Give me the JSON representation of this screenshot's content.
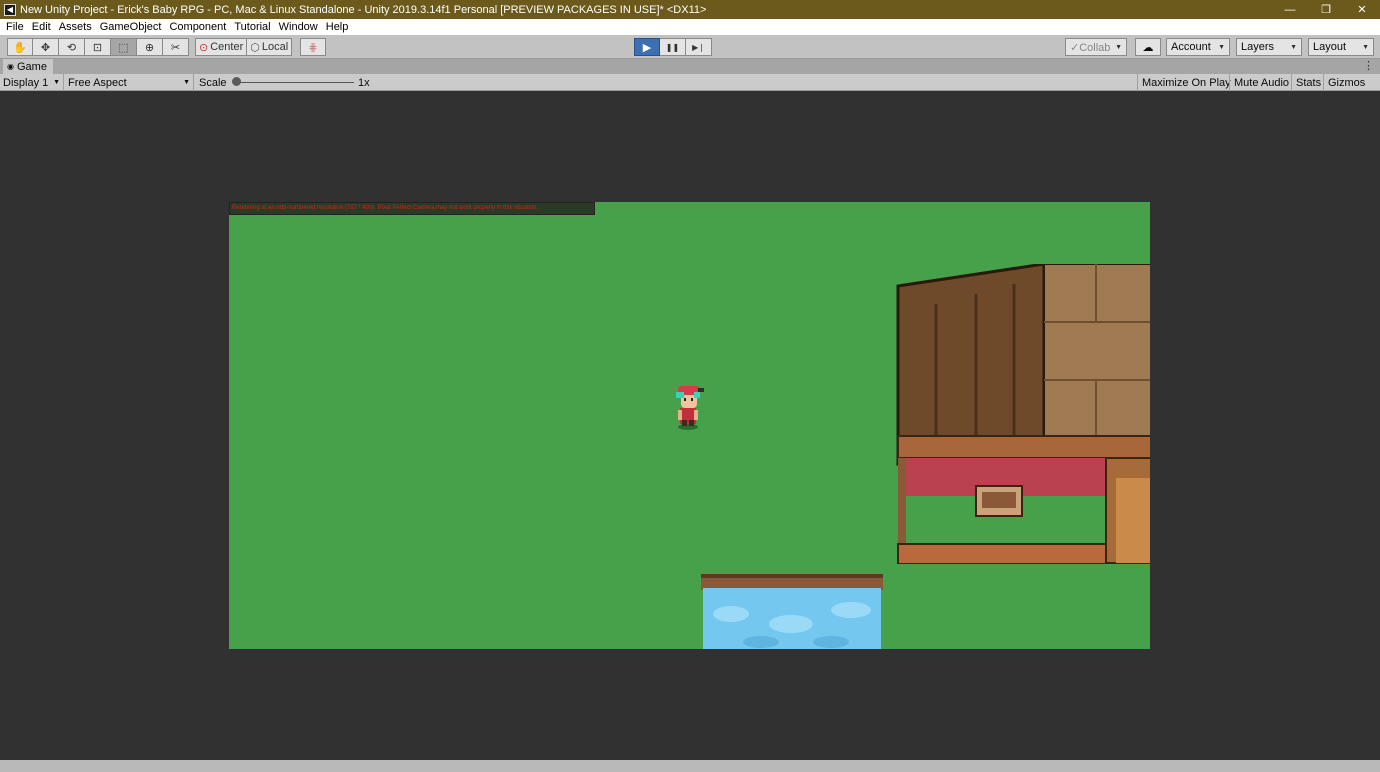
{
  "window": {
    "title": "New Unity Project - Erick's Baby RPG - PC, Mac & Linux Standalone - Unity 2019.3.14f1 Personal [PREVIEW PACKAGES IN USE]* <DX11>",
    "logo_glyph": "◀",
    "controls": {
      "minimize": "—",
      "restore": "❐",
      "close": "✕"
    }
  },
  "menu": [
    "File",
    "Edit",
    "Assets",
    "GameObject",
    "Component",
    "Tutorial",
    "Window",
    "Help"
  ],
  "toolbar": {
    "tools": [
      {
        "name": "hand-tool-icon",
        "glyph": "✋"
      },
      {
        "name": "move-tool-icon",
        "glyph": "✥"
      },
      {
        "name": "rotate-tool-icon",
        "glyph": "⟲"
      },
      {
        "name": "scale-tool-icon",
        "glyph": "⊡"
      },
      {
        "name": "rect-tool-icon",
        "glyph": "⬚"
      },
      {
        "name": "transform-tool-icon",
        "glyph": "⊕"
      },
      {
        "name": "custom-tool-icon",
        "glyph": "✂"
      }
    ],
    "pivot_label": "Center",
    "space_label": "Local",
    "grid_snap_glyph": "⋕",
    "play_glyph": "▶",
    "pause_glyph": "❚❚",
    "step_glyph": "▶❘",
    "collab_label": "Collab",
    "cloud_glyph": "☁",
    "account_label": "Account",
    "layers_label": "Layers",
    "layout_label": "Layout",
    "dropdown_arrow": "▼"
  },
  "tab": {
    "label": "Game",
    "icon_glyph": "◉",
    "menu_glyph": "⋮"
  },
  "game_toolbar": {
    "display": "Display 1",
    "aspect": "Free Aspect",
    "scale_label": "Scale",
    "scale_value": "1x",
    "scale_level": 0.0,
    "maximize": "Maximize On Play",
    "mute": "Mute Audio",
    "stats": "Stats",
    "gizmos": "Gizmos"
  },
  "game_view": {
    "warning_text": "Rendering at an odd-numbered resolution (787 * 409). Pixel Perfect Camera may not work properly in this situation.",
    "colors": {
      "grass": "#47a04a",
      "water": "#74c8ef",
      "roof": "#7a5230",
      "wall": "#b45a3c"
    }
  }
}
